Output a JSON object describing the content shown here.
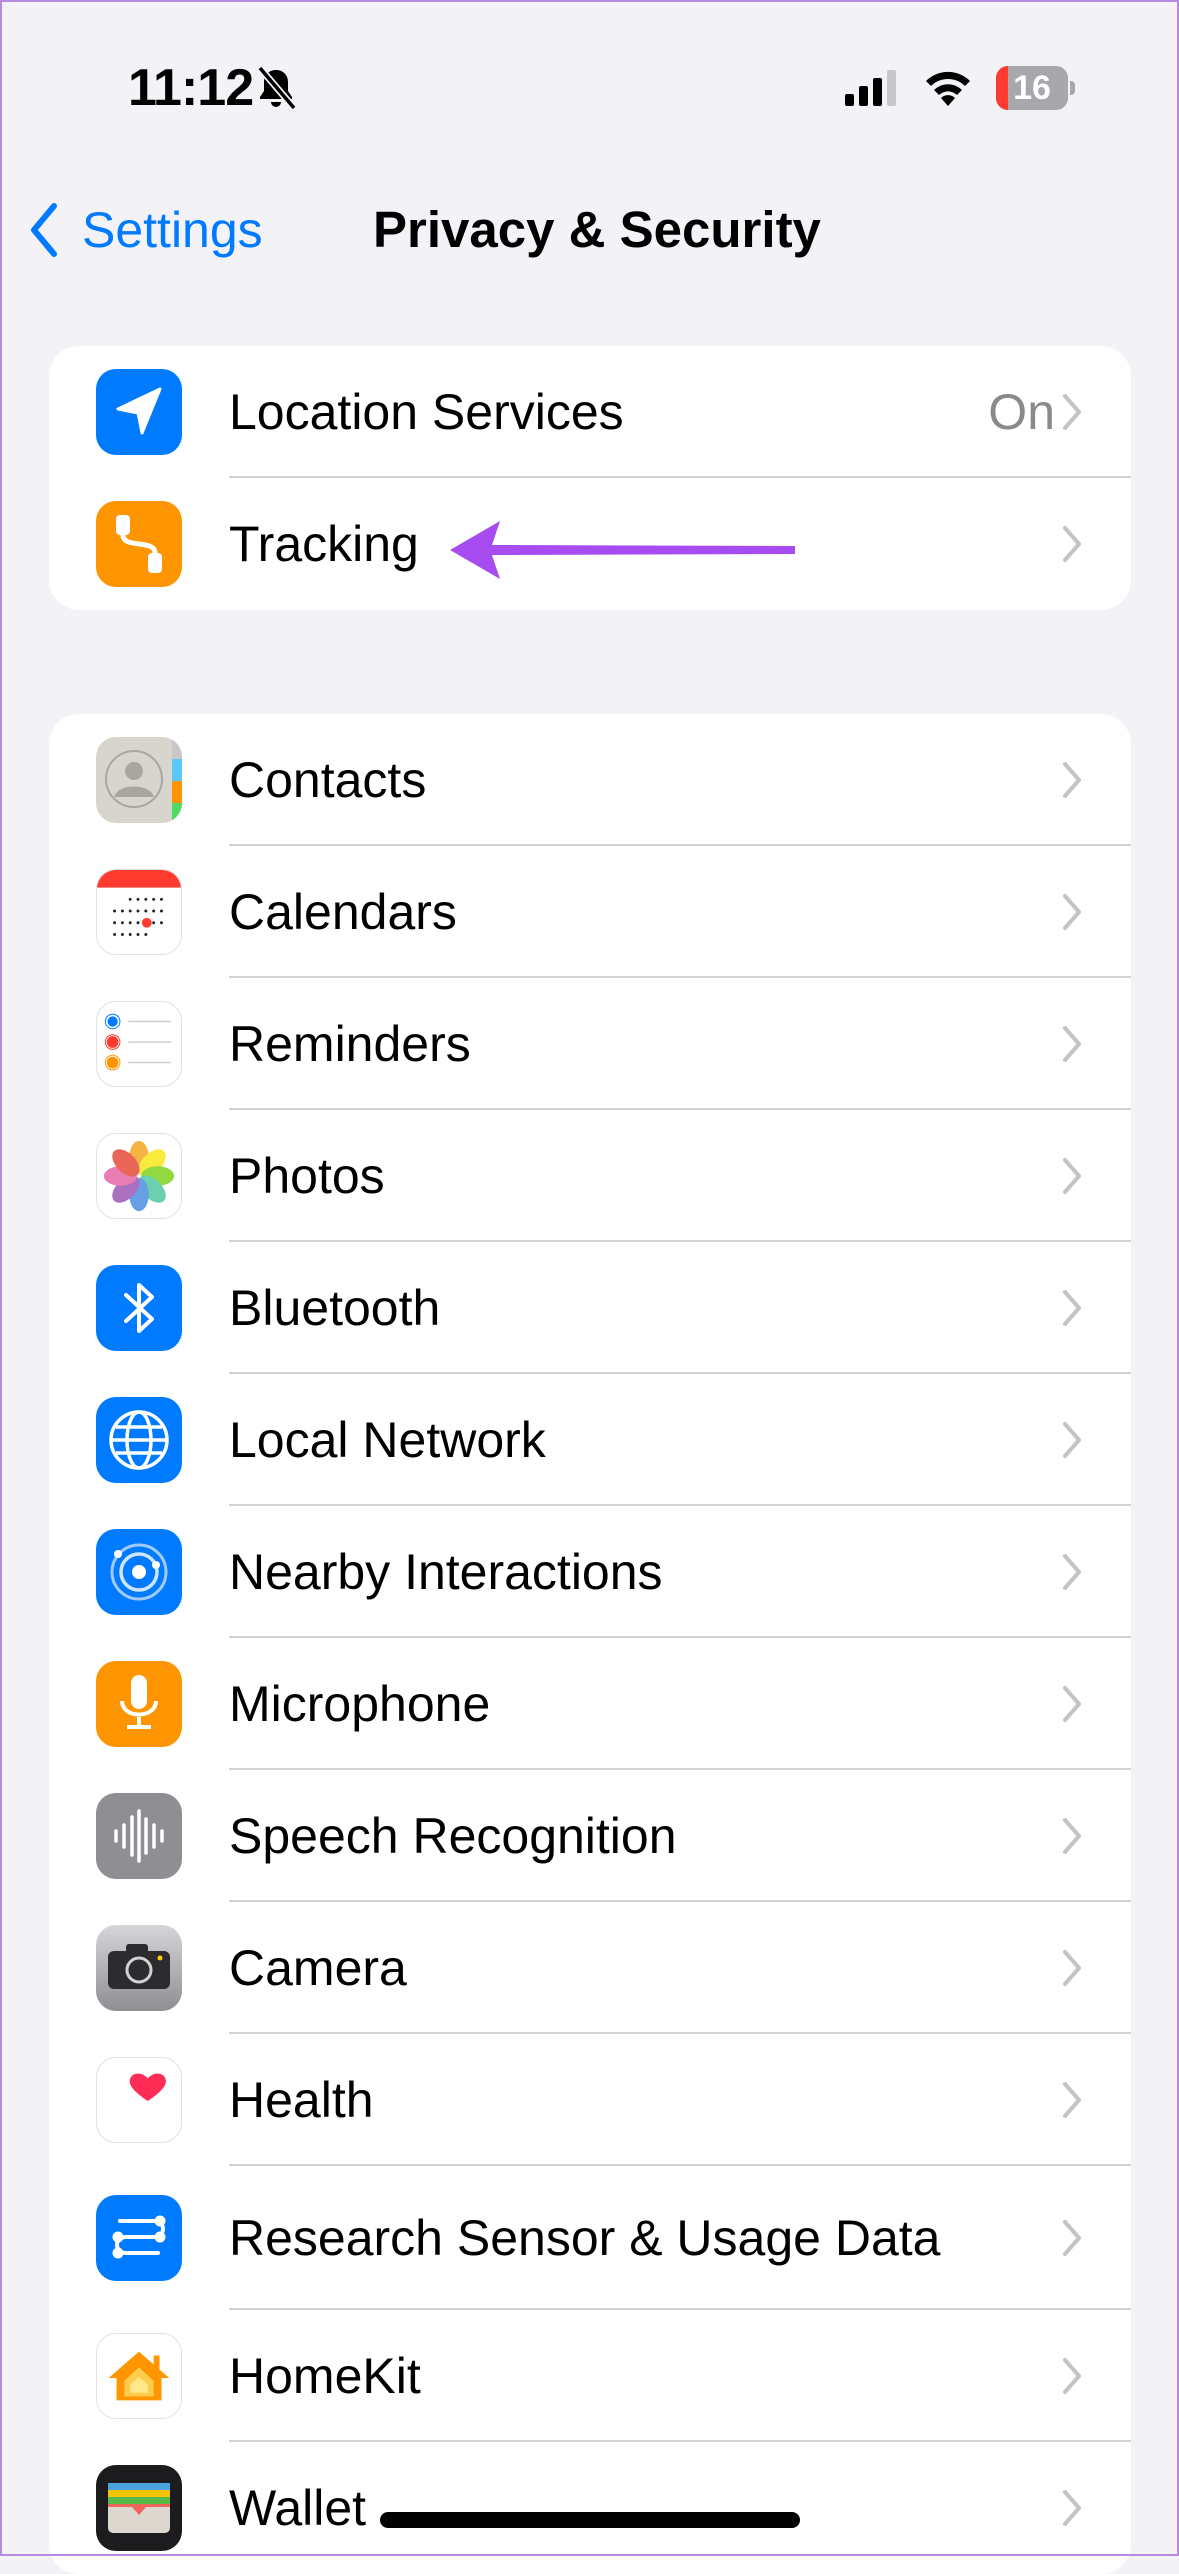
{
  "status_bar": {
    "time": "11:12",
    "silent_icon": "bell-slash-icon",
    "signal_icon": "cellular-signal-icon",
    "wifi_icon": "wifi-icon",
    "battery_level": 16,
    "battery_label": "16"
  },
  "nav": {
    "back_label": "Settings",
    "title": "Privacy & Security"
  },
  "groups": [
    {
      "rows": [
        {
          "label": "Location Services",
          "value": "On",
          "icon": "location-arrow-icon",
          "icon_bg": "#007aff"
        },
        {
          "label": "Tracking",
          "value": "",
          "icon": "tracking-icon",
          "icon_bg": "#ff9500"
        }
      ]
    },
    {
      "rows": [
        {
          "label": "Contacts",
          "icon": "contacts-icon",
          "icon_bg": "#d8d5cf"
        },
        {
          "label": "Calendars",
          "icon": "calendar-icon",
          "icon_bg": "#ffffff"
        },
        {
          "label": "Reminders",
          "icon": "reminders-icon",
          "icon_bg": "#ffffff"
        },
        {
          "label": "Photos",
          "icon": "photos-icon",
          "icon_bg": "#ffffff"
        },
        {
          "label": "Bluetooth",
          "icon": "bluetooth-icon",
          "icon_bg": "#007aff"
        },
        {
          "label": "Local Network",
          "icon": "globe-icon",
          "icon_bg": "#007aff"
        },
        {
          "label": "Nearby Interactions",
          "icon": "nearby-interactions-icon",
          "icon_bg": "#007aff"
        },
        {
          "label": "Microphone",
          "icon": "microphone-icon",
          "icon_bg": "#ff9500"
        },
        {
          "label": "Speech Recognition",
          "icon": "waveform-icon",
          "icon_bg": "#8e8e93"
        },
        {
          "label": "Camera",
          "icon": "camera-icon",
          "icon_bg": "#a0a0a5"
        },
        {
          "label": "Health",
          "icon": "heart-icon",
          "icon_bg": "#ffffff"
        },
        {
          "label": "Research Sensor & Usage Data",
          "icon": "research-sensor-icon",
          "icon_bg": "#007aff"
        },
        {
          "label": "HomeKit",
          "icon": "home-icon",
          "icon_bg": "#ffffff"
        },
        {
          "label": "Wallet",
          "icon": "wallet-icon",
          "icon_bg": "#1c1c1e"
        }
      ]
    }
  ],
  "annotation": {
    "arrow_color": "#a64cf0",
    "points_to": "Tracking"
  },
  "colors": {
    "accent": "#007aff",
    "background": "#f2f2f7",
    "separator": "#d1d1d6",
    "secondary_text": "#8a8a8e"
  }
}
